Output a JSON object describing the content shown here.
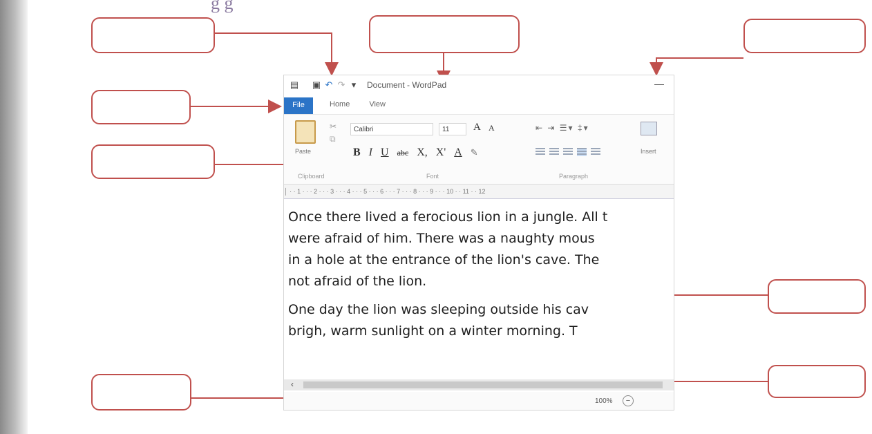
{
  "heading_fragment": "g g",
  "window": {
    "title": "Document - WordPad",
    "tabs": [
      "File",
      "Home",
      "View"
    ]
  },
  "ribbon": {
    "paste_label": "Paste",
    "font_name": "Calibri",
    "font_size": "11",
    "grow_font": "A",
    "shrink_font": "A",
    "format_buttons": [
      "B",
      "I",
      "U",
      "abc",
      "X,",
      "X'",
      "A",
      "✎"
    ],
    "insert_label": "Insert",
    "groups": [
      "Clipboard",
      "Font",
      "Paragraph"
    ]
  },
  "ruler_text": "│ · · 1 · · · 2 · · · 3 · · · 4 · · · 5 · · · 6 · · · 7 · · · 8 · · · 9 · · · 10 · · 11 · · 12",
  "document": {
    "paragraph1": [
      "Once there lived a ferocious lion in a jungle. All t",
      "were afraid of him. There was a naughty mous",
      "in a hole at the entrance of the lion's cave. The",
      "not afraid of the lion."
    ],
    "paragraph2": [
      "One day the lion was sleeping outside his cav",
      "brigh, warm sunlight on a winter morning. T"
    ]
  },
  "status": {
    "zoom": "100%",
    "zoom_out_symbol": "−"
  },
  "icons": {
    "save": "save-icon",
    "undo": "undo-icon",
    "redo": "redo-icon",
    "customize": "dropdown-icon",
    "minimize": "minimize-icon",
    "scroll_left": "chevron-left-icon"
  },
  "colors": {
    "callout_border": "#c0504d",
    "arrow": "#c0504d",
    "file_tab": "#2b74c7"
  }
}
